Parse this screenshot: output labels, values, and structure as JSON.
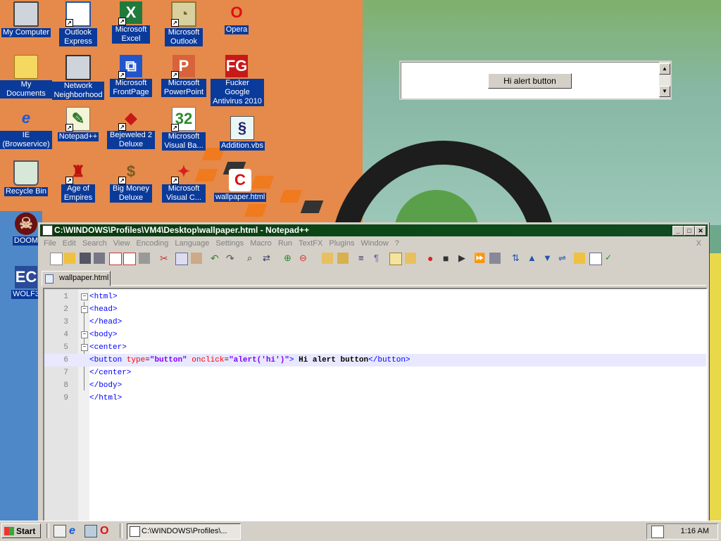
{
  "desktop": {
    "icons": [
      {
        "label": "My Computer"
      },
      {
        "label": "Outlook Express"
      },
      {
        "label": "Microsoft Excel"
      },
      {
        "label": "Microsoft Outlook"
      },
      {
        "label": "Opera"
      },
      {
        "label": "My Documents"
      },
      {
        "label": "Network Neighborhood"
      },
      {
        "label": "Microsoft FrontPage"
      },
      {
        "label": "Microsoft PowerPoint"
      },
      {
        "label": "Fucker Google Antivirus 2010"
      },
      {
        "label": "IE (Browservice)"
      },
      {
        "label": "Notepad++"
      },
      {
        "label": "Bejeweled 2 Deluxe"
      },
      {
        "label": "Microsoft Visual Ba..."
      },
      {
        "label": "Addition.vbs"
      },
      {
        "label": "Recycle Bin"
      },
      {
        "label": "Age of Empires"
      },
      {
        "label": "Big Money Deluxe"
      },
      {
        "label": "Microsoft Visual C..."
      },
      {
        "label": "wallpaper.html"
      },
      {
        "label": "DOOM"
      },
      {
        "label": "WOLF3"
      }
    ],
    "glyphs": {
      "fg": "FG",
      "wolf": "EC"
    }
  },
  "widget": {
    "button_label": "Hi alert button"
  },
  "notepad": {
    "title": "C:\\WINDOWS\\Profiles\\VM4\\Desktop\\wallpaper.html - Notepad++",
    "menu": [
      "File",
      "Edit",
      "Search",
      "View",
      "Encoding",
      "Language",
      "Settings",
      "Macro",
      "Run",
      "TextFX",
      "Plugins",
      "Window",
      "?"
    ],
    "menu_close": "X",
    "tab_label": "wallpaper.html",
    "code_lines": [
      {
        "num": "1",
        "tag": "<html>"
      },
      {
        "num": "2",
        "tag": "<head>"
      },
      {
        "num": "3",
        "tag": "</head>"
      },
      {
        "num": "4",
        "tag": "<body>"
      },
      {
        "num": "5",
        "tag": "<center>"
      },
      {
        "num": "6",
        "open": "<button",
        "attr1": " type",
        "eq1": "=",
        "val1": "\"button\"",
        "attr2": " onclick",
        "eq2": "=",
        "val2": "\"alert('hi')\"",
        "close": ">",
        "text": " Hi alert button",
        "endtag": "</button>"
      },
      {
        "num": "7",
        "tag": "</center>"
      },
      {
        "num": "8",
        "tag": "</body>"
      },
      {
        "num": "9",
        "tag": "</html>"
      }
    ],
    "window_buttons": {
      "minimize": "_",
      "maximize": "□",
      "close": "✕"
    }
  },
  "taskbar": {
    "start_label": "Start",
    "task_label": "C:\\WINDOWS\\Profiles\\...",
    "clock": "1:16 AM"
  },
  "colors": {
    "titlebar": "#0a3a10",
    "desktop_label_bg": "#0a3a9a",
    "tag_blue": "#0000ff",
    "attr_red": "#ff0000",
    "value_purple": "#8000ff"
  }
}
